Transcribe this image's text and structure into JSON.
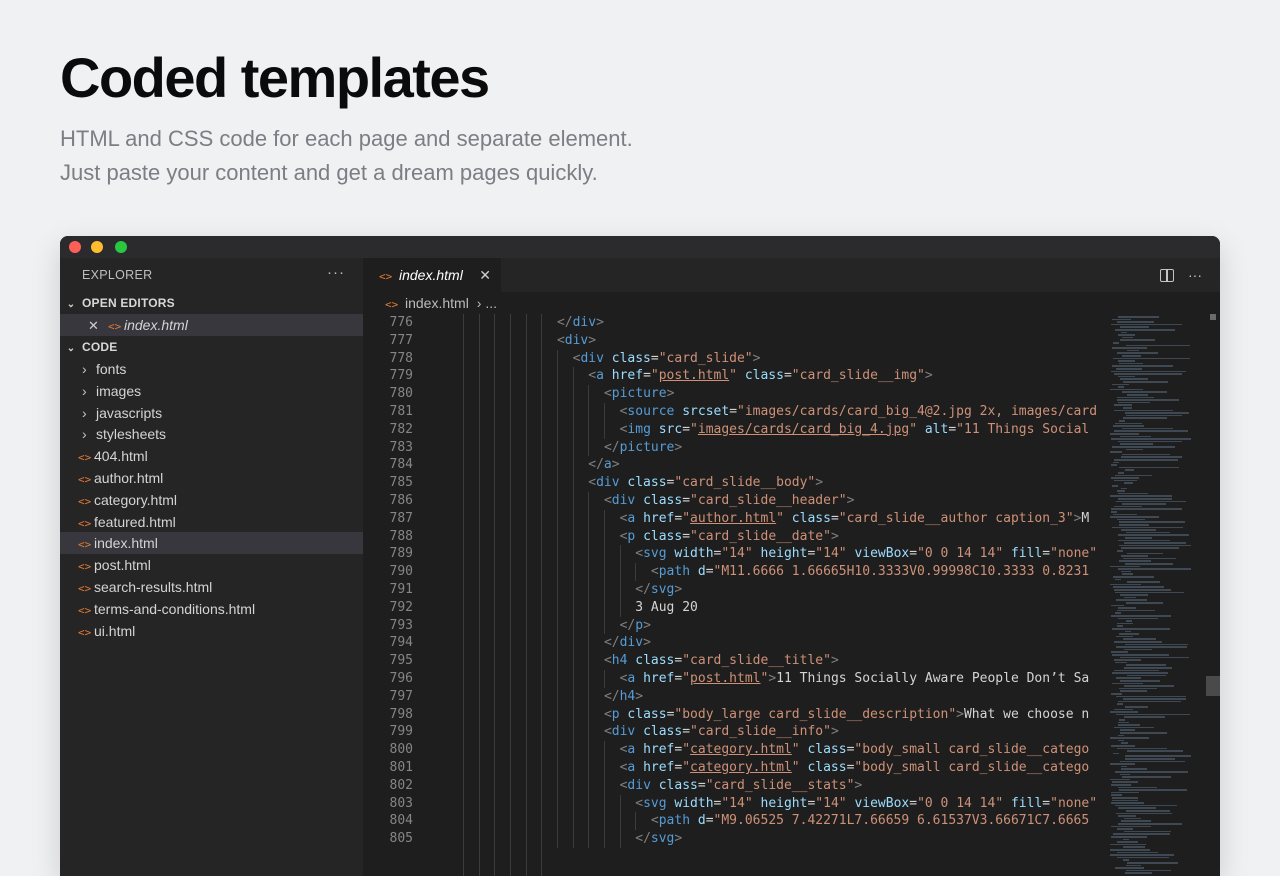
{
  "hero": {
    "title": "Coded templates",
    "subtitle_line1": "HTML and CSS code for each page and separate element.",
    "subtitle_line2": "Just paste your content and get a dream pages quickly."
  },
  "sidebar": {
    "header": "EXPLORER",
    "more": "···",
    "open_editors_label": "OPEN EDITORS",
    "open_editor_file": "index.html",
    "code_label": "CODE",
    "folders": [
      "fonts",
      "images",
      "javascripts",
      "stylesheets"
    ],
    "files": [
      "404.html",
      "author.html",
      "category.html",
      "featured.html",
      "index.html",
      "post.html",
      "search-results.html",
      "terms-and-conditions.html",
      "ui.html"
    ],
    "active_file": "index.html"
  },
  "editor": {
    "tab_label": "index.html",
    "breadcrumb_file": "index.html",
    "breadcrumb_more": "...",
    "more": "···"
  },
  "icons": {
    "html_file": "<>",
    "chevron_right": "›",
    "chevron_down": "⌄",
    "close": "✕"
  },
  "code_lines": [
    {
      "n": "776",
      "indent": 12,
      "tokens": [
        [
          "tg",
          "</"
        ],
        [
          "tn",
          "div"
        ],
        [
          "tg",
          ">"
        ]
      ]
    },
    {
      "n": "777",
      "indent": 12,
      "tokens": [
        [
          "tg",
          "<"
        ],
        [
          "tn",
          "div"
        ],
        [
          "tg",
          ">"
        ]
      ]
    },
    {
      "n": "778",
      "indent": 14,
      "tokens": [
        [
          "tg",
          "<"
        ],
        [
          "tn",
          "div"
        ],
        [
          "tx",
          " "
        ],
        [
          "at",
          "class"
        ],
        [
          "tx",
          "="
        ],
        [
          "st",
          "\"card_slide\""
        ],
        [
          "tg",
          ">"
        ]
      ]
    },
    {
      "n": "779",
      "indent": 16,
      "tokens": [
        [
          "tg",
          "<"
        ],
        [
          "tn",
          "a"
        ],
        [
          "tx",
          " "
        ],
        [
          "at",
          "href"
        ],
        [
          "tx",
          "="
        ],
        [
          "st",
          "\""
        ],
        [
          "stu",
          "post.html"
        ],
        [
          "st",
          "\""
        ],
        [
          "tx",
          " "
        ],
        [
          "at",
          "class"
        ],
        [
          "tx",
          "="
        ],
        [
          "st",
          "\"card_slide__img\""
        ],
        [
          "tg",
          ">"
        ]
      ]
    },
    {
      "n": "780",
      "indent": 18,
      "tokens": [
        [
          "tg",
          "<"
        ],
        [
          "tn",
          "picture"
        ],
        [
          "tg",
          ">"
        ]
      ]
    },
    {
      "n": "781",
      "indent": 20,
      "tokens": [
        [
          "tg",
          "<"
        ],
        [
          "tn",
          "source"
        ],
        [
          "tx",
          " "
        ],
        [
          "at",
          "srcset"
        ],
        [
          "tx",
          "="
        ],
        [
          "st",
          "\"images/cards/card_big_4@2.jpg 2x, images/card"
        ]
      ]
    },
    {
      "n": "782",
      "indent": 20,
      "tokens": [
        [
          "tg",
          "<"
        ],
        [
          "tn",
          "img"
        ],
        [
          "tx",
          " "
        ],
        [
          "at",
          "src"
        ],
        [
          "tx",
          "="
        ],
        [
          "st",
          "\""
        ],
        [
          "stu",
          "images/cards/card_big_4.jpg"
        ],
        [
          "st",
          "\""
        ],
        [
          "tx",
          " "
        ],
        [
          "at",
          "alt"
        ],
        [
          "tx",
          "="
        ],
        [
          "st",
          "\"11 Things Social"
        ]
      ]
    },
    {
      "n": "783",
      "indent": 18,
      "tokens": [
        [
          "tg",
          "</"
        ],
        [
          "tn",
          "picture"
        ],
        [
          "tg",
          ">"
        ]
      ]
    },
    {
      "n": "784",
      "indent": 16,
      "tokens": [
        [
          "tg",
          "</"
        ],
        [
          "tn",
          "a"
        ],
        [
          "tg",
          ">"
        ]
      ]
    },
    {
      "n": "785",
      "indent": 16,
      "tokens": [
        [
          "tg",
          "<"
        ],
        [
          "tn",
          "div"
        ],
        [
          "tx",
          " "
        ],
        [
          "at",
          "class"
        ],
        [
          "tx",
          "="
        ],
        [
          "st",
          "\"card_slide__body\""
        ],
        [
          "tg",
          ">"
        ]
      ]
    },
    {
      "n": "786",
      "indent": 18,
      "tokens": [
        [
          "tg",
          "<"
        ],
        [
          "tn",
          "div"
        ],
        [
          "tx",
          " "
        ],
        [
          "at",
          "class"
        ],
        [
          "tx",
          "="
        ],
        [
          "st",
          "\"card_slide__header\""
        ],
        [
          "tg",
          ">"
        ]
      ]
    },
    {
      "n": "787",
      "indent": 20,
      "tokens": [
        [
          "tg",
          "<"
        ],
        [
          "tn",
          "a"
        ],
        [
          "tx",
          " "
        ],
        [
          "at",
          "href"
        ],
        [
          "tx",
          "="
        ],
        [
          "st",
          "\""
        ],
        [
          "stu",
          "author.html"
        ],
        [
          "st",
          "\""
        ],
        [
          "tx",
          " "
        ],
        [
          "at",
          "class"
        ],
        [
          "tx",
          "="
        ],
        [
          "st",
          "\"card_slide__author caption_3\""
        ],
        [
          "tg",
          ">"
        ],
        [
          "tx",
          "M"
        ]
      ]
    },
    {
      "n": "788",
      "indent": 20,
      "tokens": [
        [
          "tg",
          "<"
        ],
        [
          "tn",
          "p"
        ],
        [
          "tx",
          " "
        ],
        [
          "at",
          "class"
        ],
        [
          "tx",
          "="
        ],
        [
          "st",
          "\"card_slide__date\""
        ],
        [
          "tg",
          ">"
        ]
      ]
    },
    {
      "n": "789",
      "indent": 22,
      "tokens": [
        [
          "tg",
          "<"
        ],
        [
          "tn",
          "svg"
        ],
        [
          "tx",
          " "
        ],
        [
          "at",
          "width"
        ],
        [
          "tx",
          "="
        ],
        [
          "st",
          "\"14\""
        ],
        [
          "tx",
          " "
        ],
        [
          "at",
          "height"
        ],
        [
          "tx",
          "="
        ],
        [
          "st",
          "\"14\""
        ],
        [
          "tx",
          " "
        ],
        [
          "at",
          "viewBox"
        ],
        [
          "tx",
          "="
        ],
        [
          "st",
          "\"0 0 14 14\""
        ],
        [
          "tx",
          " "
        ],
        [
          "at",
          "fill"
        ],
        [
          "tx",
          "="
        ],
        [
          "st",
          "\"none\""
        ]
      ]
    },
    {
      "n": "790",
      "indent": 24,
      "tokens": [
        [
          "tg",
          "<"
        ],
        [
          "tn",
          "path"
        ],
        [
          "tx",
          " "
        ],
        [
          "at",
          "d"
        ],
        [
          "tx",
          "="
        ],
        [
          "st",
          "\"M11.6666 1.66665H10.3333V0.99998C10.3333 0.8231"
        ]
      ]
    },
    {
      "n": "791",
      "indent": 22,
      "tokens": [
        [
          "tg",
          "</"
        ],
        [
          "tn",
          "svg"
        ],
        [
          "tg",
          ">"
        ]
      ]
    },
    {
      "n": "792",
      "indent": 22,
      "tokens": [
        [
          "tx",
          "3 Aug 20"
        ]
      ]
    },
    {
      "n": "793",
      "indent": 20,
      "tokens": [
        [
          "tg",
          "</"
        ],
        [
          "tn",
          "p"
        ],
        [
          "tg",
          ">"
        ]
      ]
    },
    {
      "n": "794",
      "indent": 18,
      "tokens": [
        [
          "tg",
          "</"
        ],
        [
          "tn",
          "div"
        ],
        [
          "tg",
          ">"
        ]
      ]
    },
    {
      "n": "795",
      "indent": 18,
      "tokens": [
        [
          "tg",
          "<"
        ],
        [
          "tn",
          "h4"
        ],
        [
          "tx",
          " "
        ],
        [
          "at",
          "class"
        ],
        [
          "tx",
          "="
        ],
        [
          "st",
          "\"card_slide__title\""
        ],
        [
          "tg",
          ">"
        ]
      ]
    },
    {
      "n": "796",
      "indent": 20,
      "tokens": [
        [
          "tg",
          "<"
        ],
        [
          "tn",
          "a"
        ],
        [
          "tx",
          " "
        ],
        [
          "at",
          "href"
        ],
        [
          "tx",
          "="
        ],
        [
          "st",
          "\""
        ],
        [
          "stu",
          "post.html"
        ],
        [
          "st",
          "\""
        ],
        [
          "tg",
          ">"
        ],
        [
          "tx",
          "11 Things Socially Aware People Don’t Sa"
        ]
      ]
    },
    {
      "n": "797",
      "indent": 18,
      "tokens": [
        [
          "tg",
          "</"
        ],
        [
          "tn",
          "h4"
        ],
        [
          "tg",
          ">"
        ]
      ]
    },
    {
      "n": "798",
      "indent": 18,
      "tokens": [
        [
          "tg",
          "<"
        ],
        [
          "tn",
          "p"
        ],
        [
          "tx",
          " "
        ],
        [
          "at",
          "class"
        ],
        [
          "tx",
          "="
        ],
        [
          "st",
          "\"body_large card_slide__description\""
        ],
        [
          "tg",
          ">"
        ],
        [
          "tx",
          "What we choose n"
        ]
      ]
    },
    {
      "n": "799",
      "indent": 18,
      "tokens": [
        [
          "tg",
          "<"
        ],
        [
          "tn",
          "div"
        ],
        [
          "tx",
          " "
        ],
        [
          "at",
          "class"
        ],
        [
          "tx",
          "="
        ],
        [
          "st",
          "\"card_slide__info\""
        ],
        [
          "tg",
          ">"
        ]
      ]
    },
    {
      "n": "800",
      "indent": 20,
      "tokens": [
        [
          "tg",
          "<"
        ],
        [
          "tn",
          "a"
        ],
        [
          "tx",
          " "
        ],
        [
          "at",
          "href"
        ],
        [
          "tx",
          "="
        ],
        [
          "st",
          "\""
        ],
        [
          "stu",
          "category.html"
        ],
        [
          "st",
          "\""
        ],
        [
          "tx",
          " "
        ],
        [
          "at",
          "class"
        ],
        [
          "tx",
          "="
        ],
        [
          "st",
          "\"body_small card_slide__catego"
        ]
      ]
    },
    {
      "n": "801",
      "indent": 20,
      "tokens": [
        [
          "tg",
          "<"
        ],
        [
          "tn",
          "a"
        ],
        [
          "tx",
          " "
        ],
        [
          "at",
          "href"
        ],
        [
          "tx",
          "="
        ],
        [
          "st",
          "\""
        ],
        [
          "stu",
          "category.html"
        ],
        [
          "st",
          "\""
        ],
        [
          "tx",
          " "
        ],
        [
          "at",
          "class"
        ],
        [
          "tx",
          "="
        ],
        [
          "st",
          "\"body_small card_slide__catego"
        ]
      ]
    },
    {
      "n": "802",
      "indent": 20,
      "tokens": [
        [
          "tg",
          "<"
        ],
        [
          "tn",
          "div"
        ],
        [
          "tx",
          " "
        ],
        [
          "at",
          "class"
        ],
        [
          "tx",
          "="
        ],
        [
          "st",
          "\"card_slide__stats\""
        ],
        [
          "tg",
          ">"
        ]
      ]
    },
    {
      "n": "803",
      "indent": 22,
      "tokens": [
        [
          "tg",
          "<"
        ],
        [
          "tn",
          "svg"
        ],
        [
          "tx",
          " "
        ],
        [
          "at",
          "width"
        ],
        [
          "tx",
          "="
        ],
        [
          "st",
          "\"14\""
        ],
        [
          "tx",
          " "
        ],
        [
          "at",
          "height"
        ],
        [
          "tx",
          "="
        ],
        [
          "st",
          "\"14\""
        ],
        [
          "tx",
          " "
        ],
        [
          "at",
          "viewBox"
        ],
        [
          "tx",
          "="
        ],
        [
          "st",
          "\"0 0 14 14\""
        ],
        [
          "tx",
          " "
        ],
        [
          "at",
          "fill"
        ],
        [
          "tx",
          "="
        ],
        [
          "st",
          "\"none\""
        ]
      ]
    },
    {
      "n": "804",
      "indent": 24,
      "tokens": [
        [
          "tg",
          "<"
        ],
        [
          "tn",
          "path"
        ],
        [
          "tx",
          " "
        ],
        [
          "at",
          "d"
        ],
        [
          "tx",
          "="
        ],
        [
          "st",
          "\"M9.06525 7.42271L7.66659 6.61537V3.66671C7.6665"
        ]
      ]
    },
    {
      "n": "805",
      "indent": 22,
      "tokens": [
        [
          "tg",
          "</"
        ],
        [
          "tn",
          "svg"
        ],
        [
          "tg",
          ">"
        ]
      ]
    }
  ]
}
